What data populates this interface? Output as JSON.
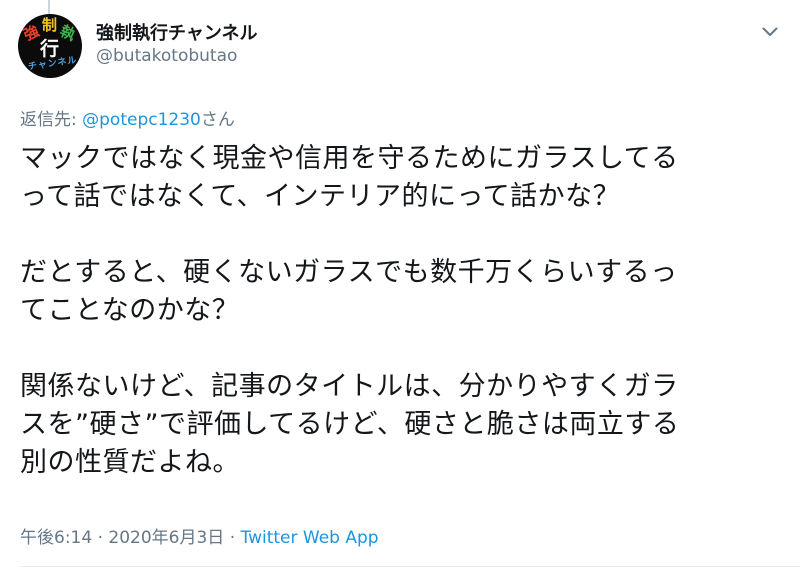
{
  "user": {
    "display_name": "強制執行チャンネル",
    "handle": "@butakotobutao",
    "avatar": {
      "chars": [
        "強",
        "制",
        "執",
        "行"
      ],
      "subtitle": "チャンネル"
    }
  },
  "menu": {
    "icon": "chevron-down-icon"
  },
  "reply": {
    "prefix": "返信先:",
    "mention": "@potepc1230",
    "suffix": "さん"
  },
  "tweet": {
    "paragraphs": [
      {
        "lines": [
          "マックではなく現金や信用を守るためにガラスしてる",
          "って話ではなくて、インテリア的にって話かな？"
        ]
      },
      {
        "lines": [
          "だとすると、硬くないガラスでも数千万くらいするっ",
          "てことなのかな？"
        ]
      },
      {
        "lines": [
          "関係ないけど、記事のタイトルは、分かりやすくガラ",
          "スを”硬さ”で評価してるけど、硬さと脆さは両立する",
          "別の性質だよね。"
        ]
      }
    ]
  },
  "meta": {
    "time": "午後6:14",
    "separator": "·",
    "date": "2020年6月3日",
    "source": "Twitter Web App"
  },
  "colors": {
    "link": "#1b95e0",
    "secondary": "#657786",
    "text": "#14171a"
  }
}
